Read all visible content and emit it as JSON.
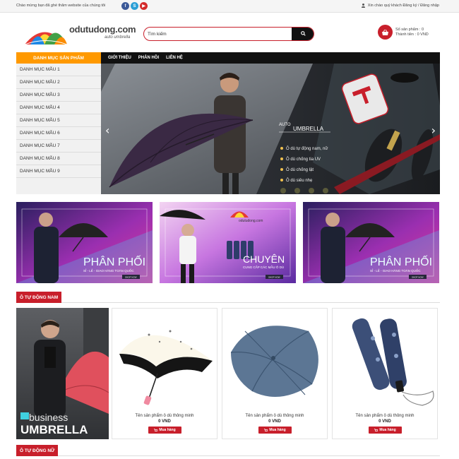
{
  "topbar": {
    "welcome": "Chào mừng bạn đã ghé thăm website của chúng tôi",
    "social": [
      "f",
      "S",
      "▶"
    ],
    "auth": "Xin chào quý khách Đăng ký / Đăng nhập"
  },
  "header": {
    "logo_text": "odutudong.com",
    "logo_sub": "auto umbrella",
    "search_placeholder": "Tìm kiếm",
    "cart_count_label": "Số sản phẩm : 0",
    "cart_total_label": "Thành tiền : 0 VND"
  },
  "nav": {
    "category_header": "DANH MỤC SẢN PHẨM",
    "links": [
      "GIỚI THIỆU",
      "PHẢN HỒI",
      "LIÊN HỆ"
    ]
  },
  "categories": [
    "DANH MỤC MẪU 1",
    "DANH MỤC MẪU 2",
    "DANH MỤC MẪU 3",
    "DANH MỤC MẪU 4",
    "DANH MỤC MẪU 5",
    "DANH MỤC MẪU 6",
    "DANH MỤC MẪU 7",
    "DANH MỤC MẪU 8",
    "DANH MỤC MẪU 9"
  ],
  "slider": {
    "title_small": "AUTO",
    "title_big": "UMBRELLA",
    "bullets": [
      "Ô dù tự động nam, nữ",
      "Ô dù chống tia UV",
      "Ô dù chống lật",
      "Ô dù siêu nhẹ"
    ]
  },
  "banners": [
    {
      "title": "PHÂN PHỐI",
      "subtitle": "SỈ - LẺ - GIAO HÀNG TOÀN QUỐC",
      "button": "SHOP NOW"
    },
    {
      "logo": "odutudong.com",
      "title": "CHUYÊN",
      "subtitle": "CUNG CẤP CÁC MẪU Ô DÙ",
      "button": "SHOP NOW"
    },
    {
      "title": "PHÂN PHỐI",
      "subtitle": "SỈ - LẺ - GIAO HÀNG TOÀN QUỐC",
      "button": "SHOP NOW"
    }
  ],
  "section_male": {
    "title": "Ô TỰ ĐỘNG NAM",
    "feature_text_1": "business",
    "feature_text_2": "UMBRELLA",
    "products": [
      {
        "name": "Tên sản phẩm ô dù thông minh",
        "price": "0 VND",
        "button": "Mua hàng"
      },
      {
        "name": "Tên sản phẩm ô dù thông minh",
        "price": "0 VND",
        "button": "Mua hàng"
      },
      {
        "name": "Tên sản phẩm ô dù thông minh",
        "price": "0 VND",
        "button": "Mua hàng"
      }
    ]
  },
  "section_female": {
    "title": "Ô TỰ ĐỘNG NỮ"
  },
  "colors": {
    "accent_red": "#c81f2b",
    "nav_black": "#111111",
    "category_orange": "#ff9900"
  }
}
